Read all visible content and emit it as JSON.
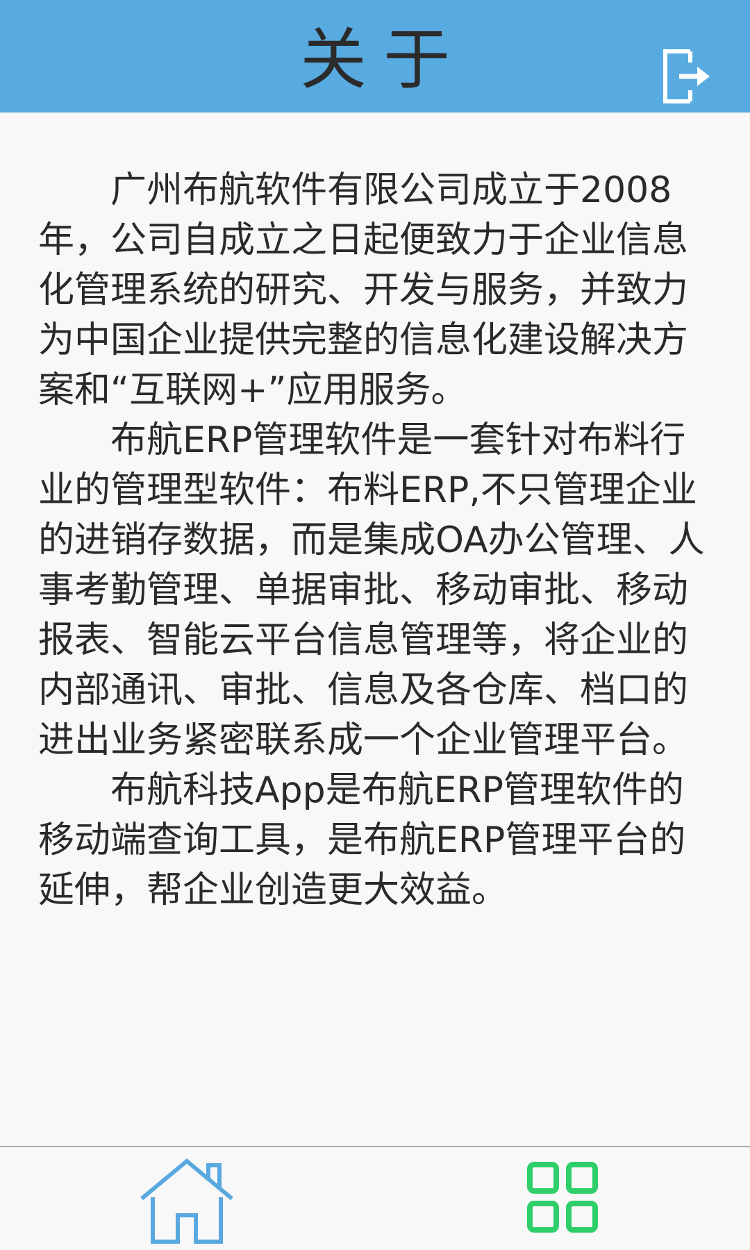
{
  "header": {
    "title": "关于",
    "logout_icon": "logout-icon",
    "background_color": "#57abe0"
  },
  "about": {
    "paragraphs": [
      "广州布航软件有限公司成立于2008年，公司自成立之日起便致力于企业信息化管理系统的研究、开发与服务，并致力为中国企业提供完整的信息化建设解决方案和“互联网+”应用服务。",
      "布航ERP管理软件是一套针对布料行业的管理型软件：布料ERP,不只管理企业的进销存数据，而是集成OA办公管理、人事考勤管理、单据审批、移动审批、移动报表、智能云平台信息管理等，将企业的内部通讯、审批、信息及各仓库、档口的进出业务紧密联系成一个企业管理平台。",
      "布航科技App是布航ERP管理软件的移动端查询工具，是布航ERP管理平台的延伸，帮企业创造更大效益。"
    ]
  },
  "bottom_nav": {
    "home_icon": "home-icon",
    "apps_icon": "apps-grid-icon",
    "home_color": "#5aa8e0",
    "apps_color": "#2ecf6a"
  }
}
